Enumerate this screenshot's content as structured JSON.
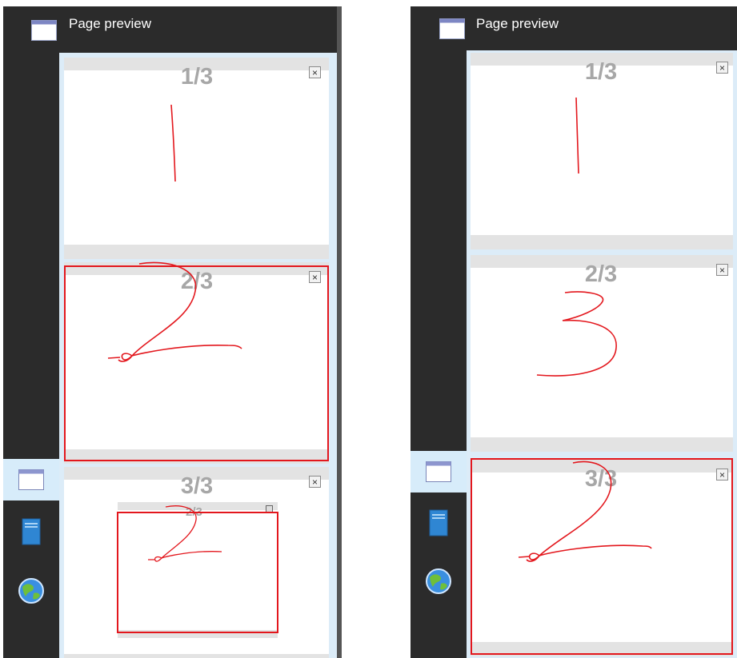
{
  "header": {
    "title": "Page preview"
  },
  "left_panel": {
    "thumbnails": [
      {
        "label": "1/3",
        "close": "×"
      },
      {
        "label": "2/3",
        "close": "×"
      },
      {
        "label": "3/3",
        "close": "×",
        "nested_label": "2/3"
      }
    ],
    "selected_index": 1
  },
  "right_panel": {
    "thumbnails": [
      {
        "label": "1/3",
        "close": "×"
      },
      {
        "label": "2/3",
        "close": "×"
      },
      {
        "label": "3/3",
        "close": "×"
      }
    ],
    "selected_index": 2
  },
  "rail_items": [
    {
      "icon": "page-window-icon",
      "active": true
    },
    {
      "icon": "book-icon",
      "active": false
    },
    {
      "icon": "globe-icon",
      "active": false
    }
  ],
  "colors": {
    "accent_red": "#e3171d",
    "rail_active": "#d7ecfa",
    "panel_bg": "#2b2b2b"
  }
}
